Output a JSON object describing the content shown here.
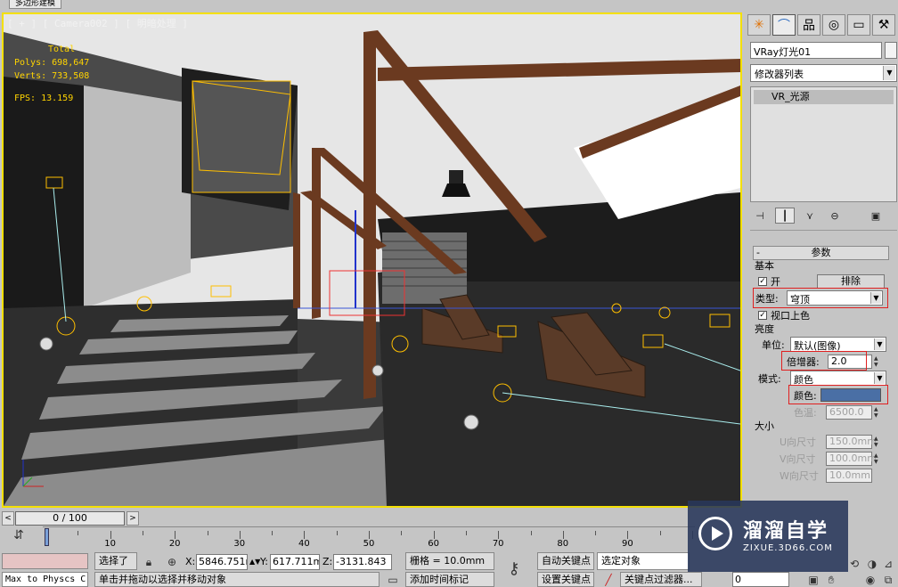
{
  "window": {
    "title_tab": "多边形建模"
  },
  "viewport": {
    "label": "[ + ] [ Camera002 ] [ 明暗处理 ]",
    "stats": {
      "total_label": "Total",
      "polys": "Polys: 698,647",
      "verts": "Verts: 733,508",
      "fps": "FPS:   13.159"
    },
    "border_color": "#f4e000"
  },
  "command_panel": {
    "tabs": [
      {
        "icon": "sun-icon",
        "glyph": "✳"
      },
      {
        "icon": "modify-icon",
        "glyph": "⌒"
      },
      {
        "icon": "hierarchy-icon",
        "glyph": "品"
      },
      {
        "icon": "motion-icon",
        "glyph": "◎"
      },
      {
        "icon": "display-icon",
        "glyph": "▭"
      },
      {
        "icon": "utilities-icon",
        "glyph": "⚒"
      }
    ],
    "object_name": "VRay灯光01",
    "modifier_list": "修改器列表",
    "stack_items": [
      "VR_光源"
    ],
    "rollout": {
      "title": "参数",
      "group_basic": "基本",
      "on_label": "开",
      "exclude_button": "排除",
      "type_label": "类型:",
      "type_value": "穹顶",
      "viewport_shade_label": "视口上色",
      "group_intensity": "亮度",
      "unit_label": "单位:",
      "unit_value": "默认(图像)",
      "multiplier_label": "倍增器:",
      "multiplier_value": "2.0",
      "mode_label": "模式:",
      "mode_value": "颜色",
      "color_label": "颜色:",
      "color_value": "#4a6fa5",
      "temp_label": "色温:",
      "temp_value": "6500.0",
      "group_size": "大小",
      "u_size_label": "U向尺寸",
      "u_size_value": "150.0mm",
      "v_size_label": "V向尺寸",
      "v_size_value": "100.0mm",
      "w_size_label": "W向尺寸",
      "w_size_value": "10.0mm"
    }
  },
  "timeline": {
    "slider_label": "0 / 100",
    "prev": "<",
    "next": ">",
    "ticks": [
      "10",
      "20",
      "30",
      "40",
      "50",
      "60",
      "70",
      "80",
      "90"
    ]
  },
  "status_bar": {
    "maxscript_text": "Max to Physcs C",
    "selected_label": "选择了",
    "x_label": "X:",
    "x_value": "5846.751m",
    "y_label": "Y:",
    "y_value": "617.711mr",
    "z_label": "Z:",
    "z_value": "-3131.843",
    "grid_label": "栅格 = 10.0mm",
    "auto_key": "自动关键点",
    "selected_object": "选定对象",
    "set_key": "设置关键点",
    "key_filters": "关键点过滤器...",
    "frame_value": "0",
    "prompt_text": "单击并拖动以选择并移动对象",
    "add_time_tag": "添加时间标记"
  },
  "watermark": {
    "title": "溜溜自学",
    "subtitle": "ZIXUE.3D66.COM"
  }
}
